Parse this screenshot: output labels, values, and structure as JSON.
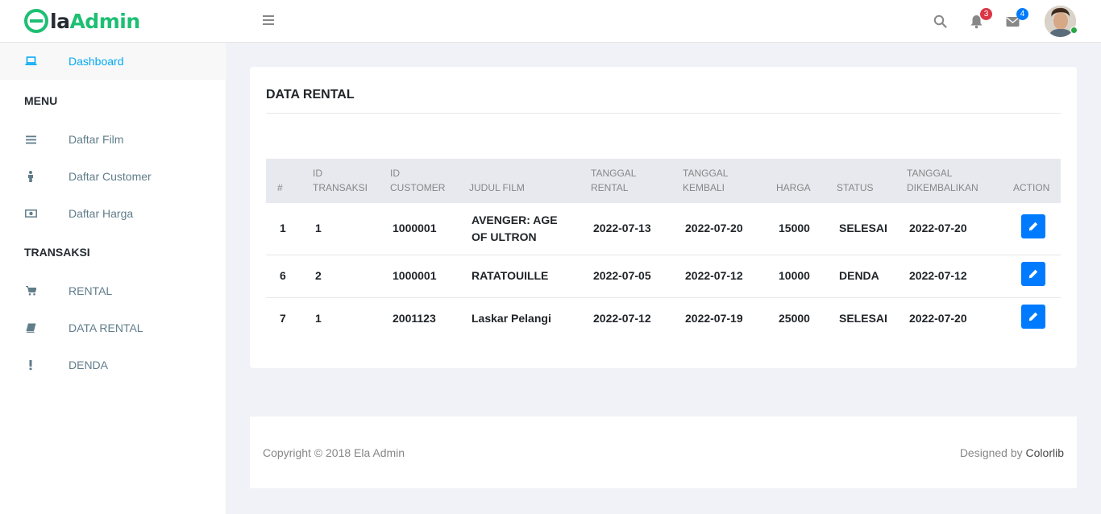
{
  "brand": {
    "logo_letter": "e",
    "logo_la": "la",
    "logo_admin": "Admin"
  },
  "header": {
    "notifications_count": "3",
    "messages_count": "4"
  },
  "sidebar": {
    "dashboard": "Dashboard",
    "menu_title": "MENU",
    "items_menu": [
      "Daftar Film",
      "Daftar Customer",
      "Daftar Harga"
    ],
    "transaksi_title": "TRANSAKSI",
    "items_transaksi": [
      "RENTAL",
      "DATA RENTAL",
      "DENDA"
    ]
  },
  "card": {
    "title": "DATA RENTAL",
    "columns": [
      "#",
      "ID TRANSAKSI",
      "ID CUSTOMER",
      "JUDUL FILM",
      "TANGGAL RENTAL",
      "TANGGAL KEMBALI",
      "HARGA",
      "STATUS",
      "TANGGAL DIKEMBALIKAN",
      "ACTION"
    ],
    "rows": [
      [
        "1",
        "1",
        "1000001",
        "AVENGER: AGE OF ULTRON",
        "2022-07-13",
        "2022-07-20",
        "15000",
        "SELESAI",
        "2022-07-20"
      ],
      [
        "6",
        "2",
        "1000001",
        "RATATOUILLE",
        "2022-07-05",
        "2022-07-12",
        "10000",
        "DENDA",
        "2022-07-12"
      ],
      [
        "7",
        "1",
        "2001123",
        "Laskar Pelangi",
        "2022-07-12",
        "2022-07-19",
        "25000",
        "SELESAI",
        "2022-07-20"
      ]
    ]
  },
  "footer": {
    "copyright": "Copyright © 2018 Ela Admin",
    "designed_by": "Designed by ",
    "designer": "Colorlib"
  },
  "colors": {
    "accent": "#03a9f3",
    "brand_green": "#1dbf73",
    "button_blue": "#007bff",
    "badge_red": "#dc3545"
  }
}
